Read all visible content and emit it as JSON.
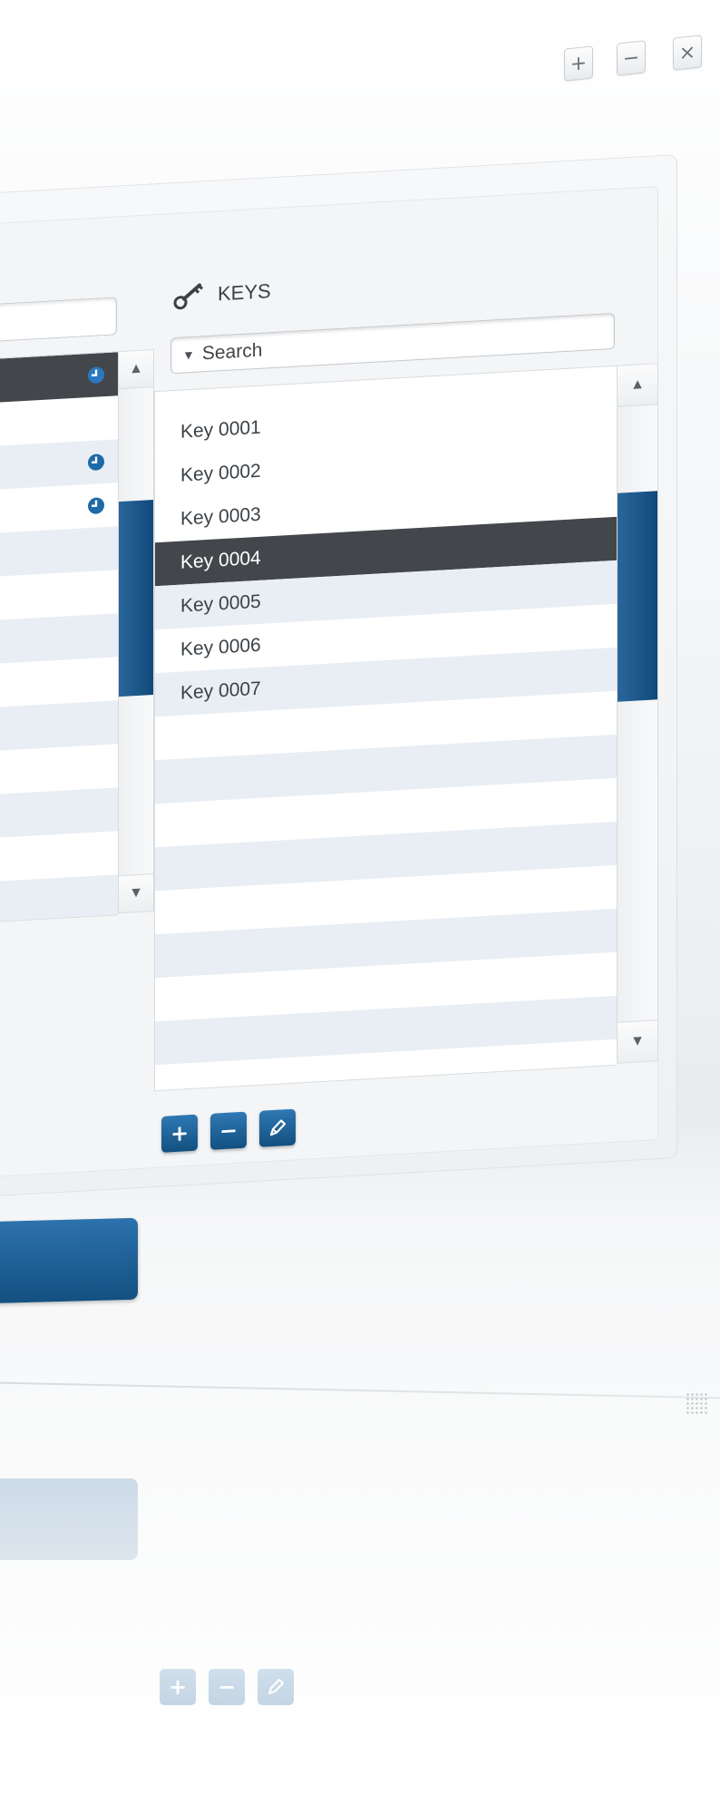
{
  "window": {
    "controls": {
      "add_label": "+",
      "minimize_label": "−",
      "close_label": "×"
    }
  },
  "keys_panel": {
    "title": "KEYS",
    "icon": "key-icon",
    "search": {
      "placeholder": "Search",
      "caret": "▼"
    },
    "items": [
      {
        "label": "Key 0001",
        "selected": false
      },
      {
        "label": "Key 0002",
        "selected": false
      },
      {
        "label": "Key 0003",
        "selected": false
      },
      {
        "label": "Key 0004",
        "selected": true
      },
      {
        "label": "Key 0005",
        "selected": false
      },
      {
        "label": "Key 0006",
        "selected": false
      },
      {
        "label": "Key 0007",
        "selected": false
      }
    ],
    "scroll": {
      "up_label": "▲",
      "down_label": "▼"
    },
    "actions": {
      "add_label": "+",
      "remove_label": "−",
      "edit_icon": "pencil-icon"
    }
  },
  "left_panel": {
    "scroll": {
      "up_label": "▲",
      "down_label": "▼"
    },
    "clock_icon": "clock-icon"
  },
  "colors": {
    "accent_blue": "#1b5688",
    "selected_row": "#43474b",
    "alt_row": "#e8eef4"
  }
}
